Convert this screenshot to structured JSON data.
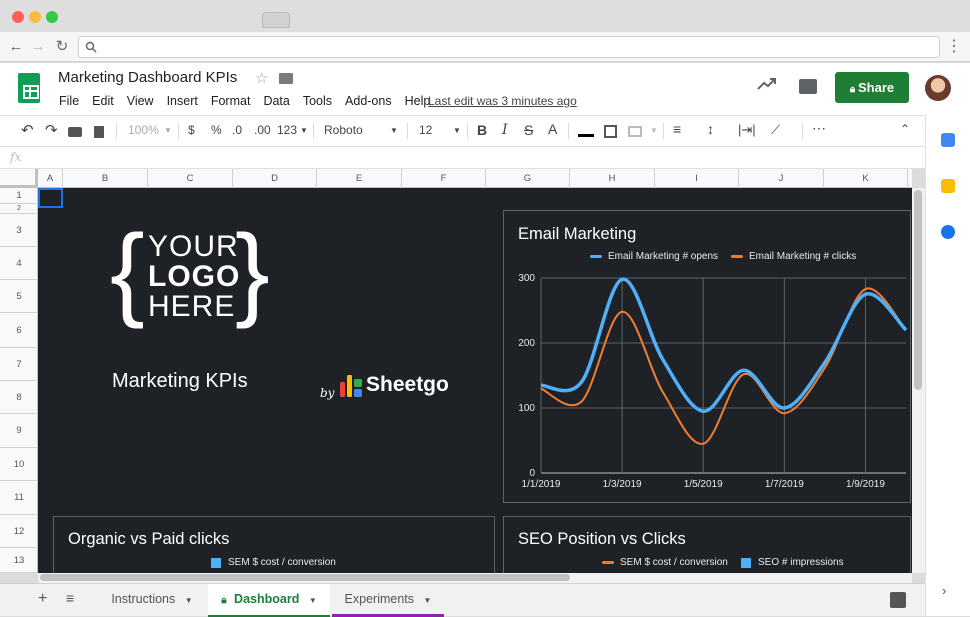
{
  "browser": {
    "menu_glyph": "⋮"
  },
  "app": {
    "title": "Marketing Dashboard KPIs",
    "menus": [
      "File",
      "Edit",
      "View",
      "Insert",
      "Format",
      "Data",
      "Tools",
      "Add-ons",
      "Help"
    ],
    "last_edit": "Last edit was 3 minutes ago",
    "share_label": "Share"
  },
  "toolbar": {
    "zoom": "100%",
    "currency": "$",
    "percent": "%",
    "dec_less": ".0",
    "dec_more": ".00",
    "more_formats": "123",
    "font": "Roboto",
    "font_size": "12",
    "bold": "B",
    "italic": "I",
    "strike": "S",
    "text_color": "A",
    "more": "⋯"
  },
  "formula": {
    "fx": "fx"
  },
  "columns": [
    "A",
    "B",
    "C",
    "D",
    "E",
    "F",
    "G",
    "H",
    "I",
    "J",
    "K"
  ],
  "rows": [
    "1",
    "2",
    "3",
    "4",
    "5",
    "6",
    "7",
    "8",
    "9",
    "10",
    "11",
    "12",
    "13"
  ],
  "logo": {
    "line1": "YOUR",
    "line2": "LOGO",
    "line3": "HERE"
  },
  "dashboard": {
    "kpi_title": "Marketing KPIs",
    "by": "by",
    "sheetgo": "Sheetgo"
  },
  "charts": {
    "email": {
      "title": "Email Marketing"
    },
    "organic": {
      "title": "Organic vs Paid clicks",
      "legend": "SEM $ cost / conversion"
    },
    "seo": {
      "title": "SEO Position vs Clicks",
      "legend1": "SEM $ cost / conversion",
      "legend2": "SEO # impressions"
    }
  },
  "chart_data": {
    "type": "line",
    "title": "Email Marketing",
    "x": [
      "1/1/2019",
      "1/2/2019",
      "1/3/2019",
      "1/4/2019",
      "1/5/2019",
      "1/6/2019",
      "1/7/2019",
      "1/8/2019",
      "1/9/2019",
      "1/10/2019"
    ],
    "x_tick_labels": [
      "1/1/2019",
      "1/3/2019",
      "1/5/2019",
      "1/7/2019",
      "1/9/2019"
    ],
    "series": [
      {
        "name": "Email Marketing # opens",
        "color": "#4fb0f7",
        "values": [
          135,
          140,
          298,
          175,
          95,
          158,
          100,
          170,
          275,
          220
        ]
      },
      {
        "name": "Email Marketing # clicks",
        "color": "#f07d30",
        "values": [
          130,
          110,
          248,
          125,
          45,
          152,
          92,
          162,
          283,
          220
        ]
      }
    ],
    "ylim": [
      0,
      300
    ],
    "yticks": [
      0,
      100,
      200,
      300
    ],
    "grid": true,
    "legend": "top"
  },
  "sheets": [
    {
      "label": "Instructions",
      "active": false
    },
    {
      "label": "Dashboard",
      "active": true
    },
    {
      "label": "Experiments",
      "active": false
    }
  ],
  "colors": {
    "accent": "#1e7e34",
    "blue_series": "#4fb0f7",
    "orange_series": "#f07d30",
    "dark_bg": "#1e2227"
  }
}
